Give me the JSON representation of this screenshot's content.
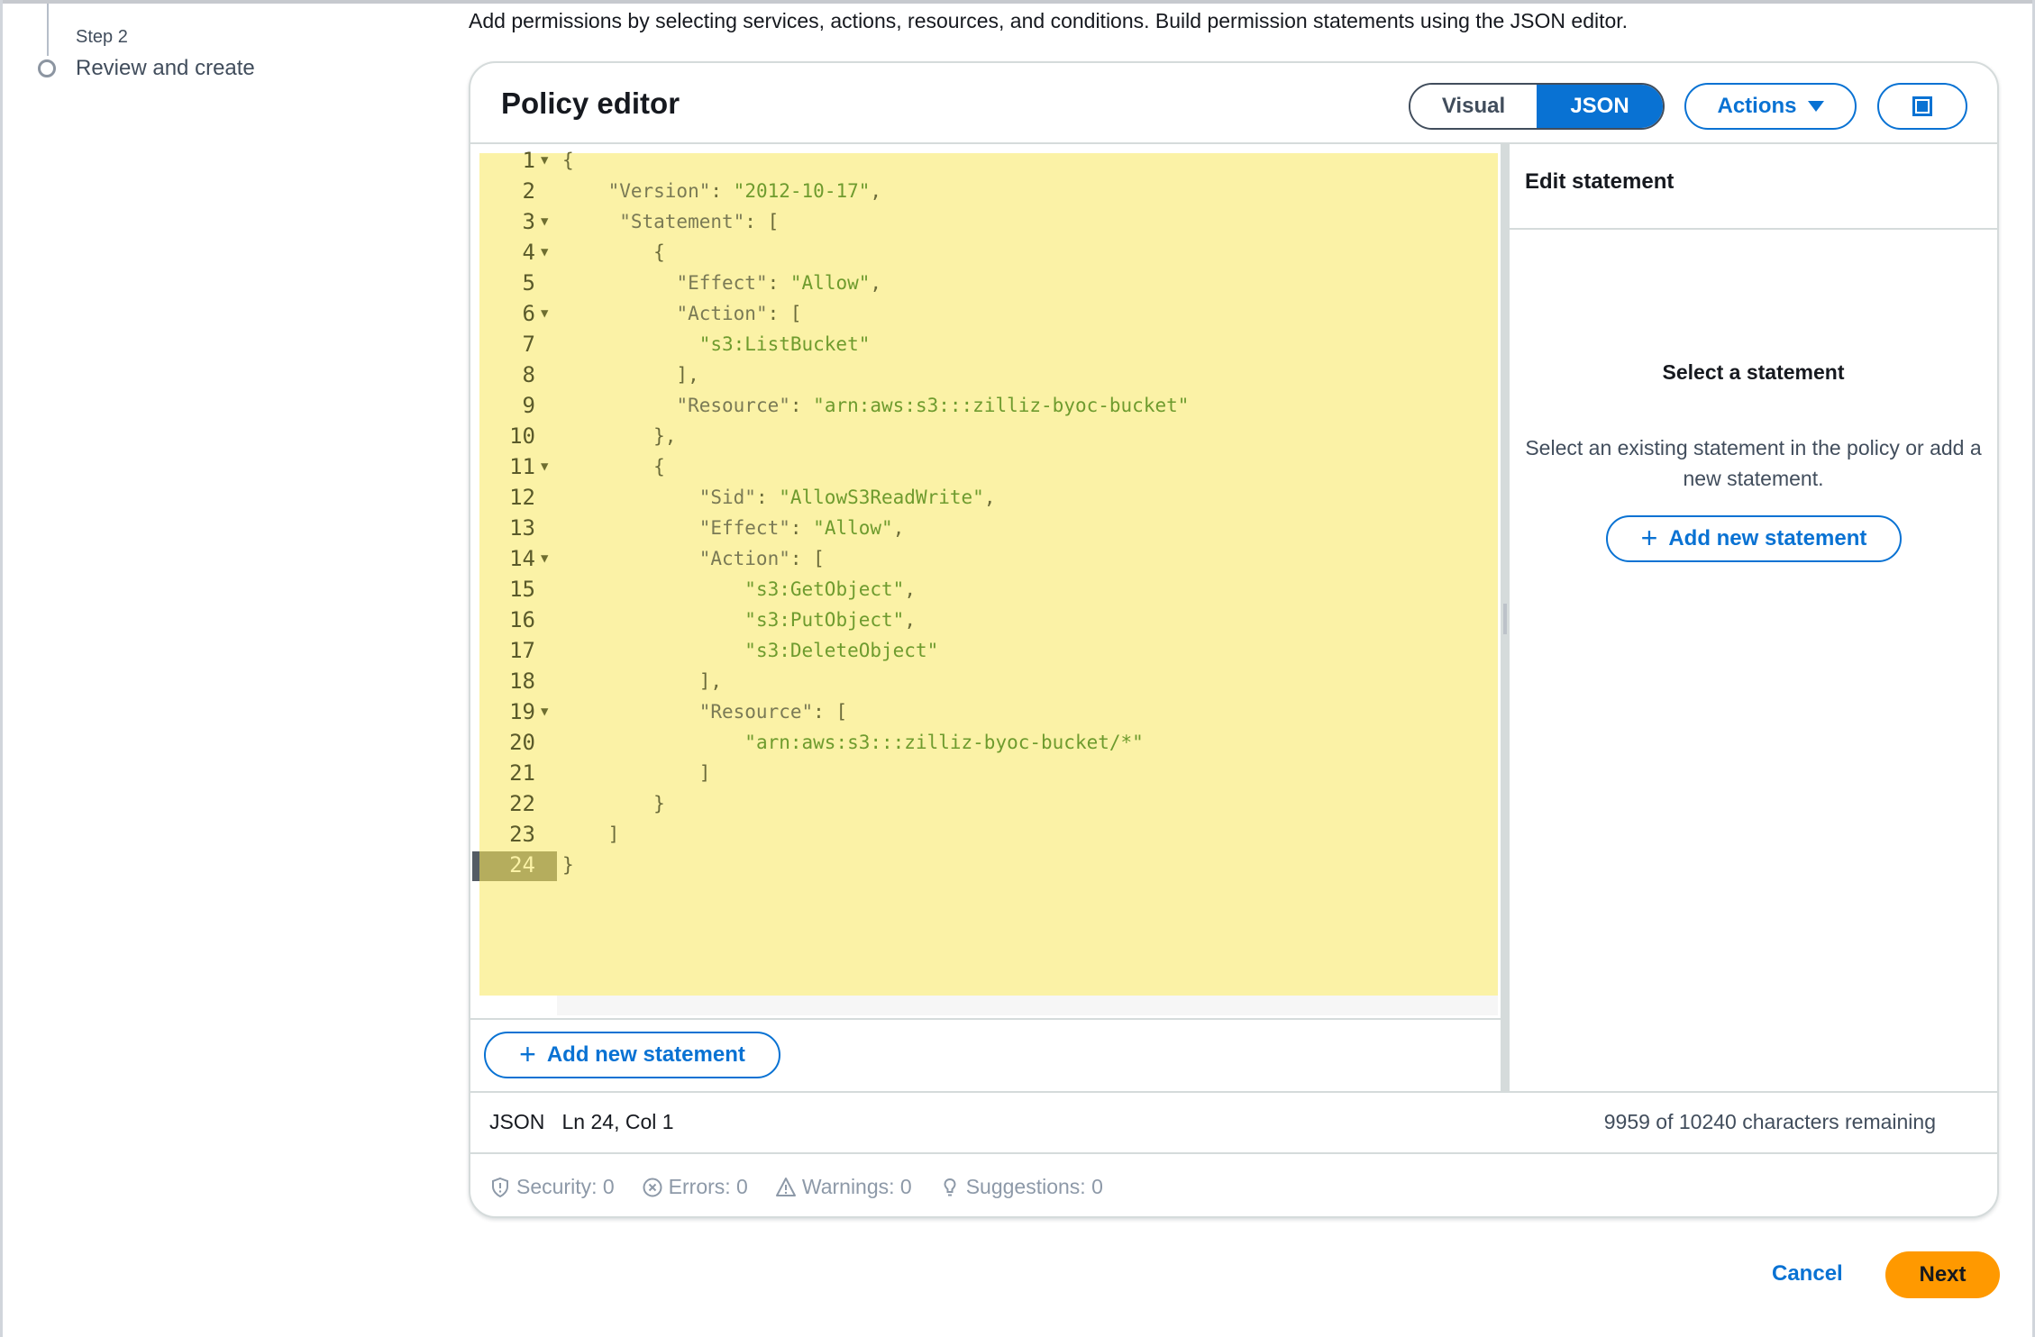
{
  "steps": {
    "step_number": "Step 2",
    "step_label": "Review and create"
  },
  "description": "Add permissions by selecting services, actions, resources, and conditions. Build permission statements using the JSON editor.",
  "policy_editor": {
    "title": "Policy editor",
    "mode_toggle": {
      "visual": "Visual",
      "json": "JSON",
      "selected": "JSON"
    },
    "actions_label": "Actions",
    "code_lines": [
      {
        "n": "1",
        "fold": true,
        "text": "{"
      },
      {
        "n": "2",
        "fold": false,
        "text": "    \"Version\": \"2012-10-17\","
      },
      {
        "n": "3",
        "fold": true,
        "text": "     \"Statement\": ["
      },
      {
        "n": "4",
        "fold": true,
        "text": "        {"
      },
      {
        "n": "5",
        "fold": false,
        "text": "          \"Effect\": \"Allow\","
      },
      {
        "n": "6",
        "fold": true,
        "text": "          \"Action\": ["
      },
      {
        "n": "7",
        "fold": false,
        "text": "            \"s3:ListBucket\""
      },
      {
        "n": "8",
        "fold": false,
        "text": "          ],"
      },
      {
        "n": "9",
        "fold": false,
        "text": "          \"Resource\": \"arn:aws:s3:::zilliz-byoc-bucket\""
      },
      {
        "n": "10",
        "fold": false,
        "text": "        },"
      },
      {
        "n": "11",
        "fold": true,
        "text": "        {"
      },
      {
        "n": "12",
        "fold": false,
        "text": "            \"Sid\": \"AllowS3ReadWrite\","
      },
      {
        "n": "13",
        "fold": false,
        "text": "            \"Effect\": \"Allow\","
      },
      {
        "n": "14",
        "fold": true,
        "text": "            \"Action\": ["
      },
      {
        "n": "15",
        "fold": false,
        "text": "                \"s3:GetObject\","
      },
      {
        "n": "16",
        "fold": false,
        "text": "                \"s3:PutObject\","
      },
      {
        "n": "17",
        "fold": false,
        "text": "                \"s3:DeleteObject\""
      },
      {
        "n": "18",
        "fold": false,
        "text": "            ],"
      },
      {
        "n": "19",
        "fold": true,
        "text": "            \"Resource\": ["
      },
      {
        "n": "20",
        "fold": false,
        "text": "                \"arn:aws:s3:::zilliz-byoc-bucket/*\""
      },
      {
        "n": "21",
        "fold": false,
        "text": "            ]"
      },
      {
        "n": "22",
        "fold": false,
        "text": "        }"
      },
      {
        "n": "23",
        "fold": false,
        "text": "    ]"
      },
      {
        "n": "24",
        "fold": false,
        "text": "}"
      }
    ],
    "active_line": 24,
    "add_statement_label": "Add new statement",
    "status": {
      "language": "JSON",
      "cursor": "Ln 24, Col 1",
      "chars_remaining": "9959 of 10240 characters remaining"
    },
    "diagnostics": [
      {
        "icon": "shield-icon",
        "label": "Security: 0"
      },
      {
        "icon": "error-circle-icon",
        "label": "Errors: 0"
      },
      {
        "icon": "warning-icon",
        "label": "Warnings: 0"
      },
      {
        "icon": "lightbulb-icon",
        "label": "Suggestions: 0"
      }
    ]
  },
  "side_panel": {
    "title": "Edit statement",
    "empty_title": "Select a statement",
    "empty_description": "Select an existing statement in the policy or add a new statement.",
    "add_statement_label": "Add new statement"
  },
  "footer": {
    "cancel_label": "Cancel",
    "next_label": "Next"
  },
  "colors": {
    "primary": "#0972d3",
    "next_button": "#ff9900",
    "code_highlight": "#fbf2a6"
  }
}
